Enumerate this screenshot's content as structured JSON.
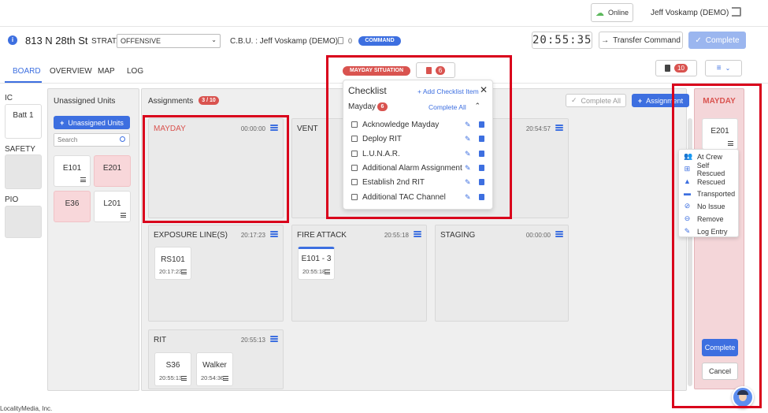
{
  "header": {
    "online_label": "Online",
    "user_name": "Jeff Voskamp (DEMO)",
    "address": "813 N 28th St",
    "strat_label": "STRAT.",
    "strat_value": "OFFENSIVE",
    "cbu_label": "C.B.U. : Jeff Voskamp (DEMO)",
    "count": "0",
    "command_badge": "COMMAND",
    "clock": "20:55:35",
    "transfer_label": "Transfer Command",
    "complete_label": "Complete"
  },
  "tabs": [
    "BOARD",
    "OVERVIEW",
    "MAP",
    "LOG"
  ],
  "mayday_situation": {
    "badge": "MAYDAY SITUATION",
    "count": "6",
    "right_count": "10"
  },
  "sidebar": {
    "ic_label": "IC",
    "ic_unit": "Batt 1",
    "safety_label": "SAFETY",
    "pio_label": "PIO"
  },
  "unassigned": {
    "title": "Unassigned Units",
    "button": "Unassigned Units",
    "search_placeholder": "Search",
    "units": [
      "E101",
      "E201",
      "E36",
      "L201"
    ]
  },
  "assignments": {
    "title": "Assignments",
    "badge": "3 / 10",
    "complete_all": "Complete All",
    "add_button": "Assignment",
    "columns": {
      "mayday": {
        "name": "MAYDAY",
        "time": "00:00:00"
      },
      "vent": {
        "name": "VENT",
        "time": "20:54:57"
      },
      "exposure": {
        "name": "EXPOSURE LINE(S)",
        "time": "20:17:23",
        "unit": "RS101",
        "unit_time": "20:17:23"
      },
      "fire_attack": {
        "name": "FIRE ATTACK",
        "time": "20:55:18",
        "unit": "E101 - 3",
        "unit_time": "20:55:18"
      },
      "staging": {
        "name": "STAGING",
        "time": "00:00:00"
      },
      "rit": {
        "name": "RIT",
        "time": "20:55:13",
        "units": [
          {
            "name": "S36",
            "time": "20:55:13"
          },
          {
            "name": "Walker",
            "time": "20:54:36"
          }
        ]
      }
    }
  },
  "checklist": {
    "title": "Checklist",
    "add_link": "+ Add Checklist Item",
    "section": "Mayday",
    "section_count": "6",
    "complete_all": "Complete All",
    "items": [
      "Acknowledge Mayday",
      "Deploy RIT",
      "L.U.N.A.R.",
      "Additional Alarm Assignment",
      "Establish 2nd RIT",
      "Additional TAC Channel"
    ]
  },
  "mayday_panel": {
    "title": "MAYDAY",
    "unit": "E201",
    "menu_items": [
      "At Crew",
      "Self Rescued",
      "Rescued",
      "Transported",
      "No Issue",
      "Remove",
      "Log Entry"
    ],
    "complete": "Complete",
    "cancel": "Cancel"
  },
  "footer": {
    "company": "LocalityMedia, Inc."
  },
  "colors": {
    "accent": "#3d6fe0",
    "mayday_red": "#d9534f",
    "highlight_box": "#d9001b",
    "unit_pink": "#f8d7da"
  }
}
